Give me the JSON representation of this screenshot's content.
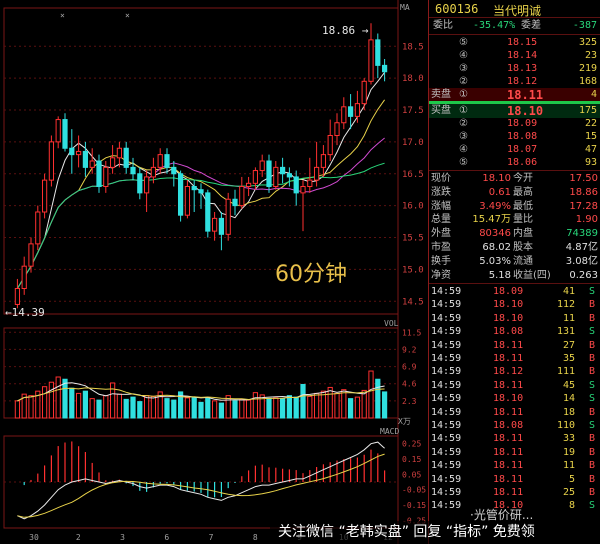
{
  "annotation": "60分钟",
  "chart_labels": {
    "ma_tag": "MA",
    "vol_tag": "VOL",
    "macd_tag": "MACD",
    "vol_unit": "X万",
    "high_label": "18.86 →",
    "low_label": "←14.39",
    "x_ticks": [
      "30",
      "2",
      "3",
      "6",
      "7",
      "8",
      "9",
      "10",
      "12"
    ]
  },
  "footer": {
    "text": "关注微信 “老韩实盘” 回复 “指标” 免费领",
    "wechat": "·光管价研..."
  },
  "chart_data": {
    "type": "candlestick",
    "price_ylim": [
      14.3,
      19.1
    ],
    "price_ticks": [
      "18.5",
      "18.0",
      "17.5",
      "17.0",
      "16.5",
      "16.0",
      "15.5",
      "15.0",
      "14.5"
    ],
    "vol_ticks": [
      "11.5",
      "9.2",
      "6.9",
      "4.6",
      "2.3"
    ],
    "macd_ticks": [
      "0.25",
      "0.15",
      "0.05",
      "-0.05",
      "-0.15",
      "-0.25"
    ],
    "candles": [
      [
        14.45,
        14.7,
        14.39,
        14.85
      ],
      [
        14.7,
        15.05,
        14.6,
        15.2
      ],
      [
        15.05,
        15.4,
        14.95,
        15.5
      ],
      [
        15.4,
        15.9,
        15.3,
        16.0
      ],
      [
        15.9,
        16.4,
        15.8,
        16.5
      ],
      [
        16.4,
        17.0,
        16.3,
        17.1
      ],
      [
        17.0,
        17.35,
        16.9,
        17.4
      ],
      [
        17.35,
        16.9,
        16.85,
        17.45
      ],
      [
        16.9,
        16.8,
        16.5,
        17.2
      ],
      [
        16.8,
        16.85,
        16.6,
        17.1
      ],
      [
        16.85,
        16.6,
        16.45,
        17.0
      ],
      [
        16.6,
        16.7,
        16.5,
        16.9
      ],
      [
        16.7,
        16.3,
        16.2,
        16.8
      ],
      [
        16.3,
        16.6,
        16.2,
        16.7
      ],
      [
        16.6,
        16.75,
        16.5,
        16.95
      ],
      [
        16.75,
        16.9,
        16.6,
        17.0
      ],
      [
        16.9,
        16.6,
        16.5,
        17.0
      ],
      [
        16.6,
        16.5,
        16.4,
        16.75
      ],
      [
        16.5,
        16.2,
        16.1,
        16.6
      ],
      [
        16.2,
        16.45,
        15.9,
        16.55
      ],
      [
        16.45,
        16.6,
        16.35,
        16.75
      ],
      [
        16.6,
        16.8,
        16.5,
        16.9
      ],
      [
        16.8,
        16.6,
        16.5,
        16.9
      ],
      [
        16.6,
        16.5,
        16.3,
        16.7
      ],
      [
        16.5,
        15.85,
        15.75,
        16.55
      ],
      [
        15.85,
        16.3,
        15.8,
        16.4
      ],
      [
        16.3,
        16.25,
        15.9,
        16.4
      ],
      [
        16.25,
        16.2,
        15.95,
        16.35
      ],
      [
        16.2,
        15.6,
        15.5,
        16.25
      ],
      [
        15.6,
        15.8,
        15.45,
        15.9
      ],
      [
        15.8,
        15.55,
        15.3,
        15.9
      ],
      [
        15.55,
        16.1,
        15.45,
        16.2
      ],
      [
        16.1,
        16.0,
        15.85,
        16.25
      ],
      [
        16.0,
        16.3,
        15.95,
        16.45
      ],
      [
        16.3,
        16.35,
        16.15,
        16.45
      ],
      [
        16.35,
        16.55,
        16.25,
        16.6
      ],
      [
        16.55,
        16.7,
        16.45,
        16.8
      ],
      [
        16.7,
        16.3,
        16.2,
        16.8
      ],
      [
        16.3,
        16.6,
        16.25,
        16.7
      ],
      [
        16.6,
        16.5,
        16.35,
        16.75
      ],
      [
        16.5,
        16.45,
        16.3,
        16.6
      ],
      [
        16.45,
        16.2,
        16.0,
        16.55
      ],
      [
        16.2,
        16.3,
        15.6,
        16.4
      ],
      [
        16.3,
        16.4,
        16.2,
        16.75
      ],
      [
        16.4,
        16.6,
        16.3,
        17.0
      ],
      [
        16.6,
        16.8,
        16.45,
        16.95
      ],
      [
        16.8,
        17.1,
        16.7,
        17.35
      ],
      [
        17.1,
        17.3,
        16.95,
        17.45
      ],
      [
        17.3,
        17.55,
        17.2,
        17.7
      ],
      [
        17.55,
        17.4,
        17.2,
        17.75
      ],
      [
        17.4,
        17.6,
        17.3,
        17.8
      ],
      [
        17.6,
        17.95,
        17.5,
        18.0
      ],
      [
        17.95,
        18.6,
        17.9,
        18.86
      ],
      [
        18.6,
        18.2,
        18.0,
        18.7
      ],
      [
        18.2,
        18.1,
        17.95,
        18.3
      ]
    ],
    "volumes": [
      [
        2.3,
        1
      ],
      [
        3.2,
        1
      ],
      [
        3.0,
        1
      ],
      [
        3.6,
        1
      ],
      [
        4.2,
        1
      ],
      [
        4.8,
        1
      ],
      [
        5.5,
        1
      ],
      [
        5.2,
        0
      ],
      [
        4.0,
        0
      ],
      [
        3.3,
        1
      ],
      [
        3.6,
        0
      ],
      [
        2.6,
        1
      ],
      [
        2.4,
        0
      ],
      [
        3.0,
        1
      ],
      [
        4.7,
        1
      ],
      [
        3.2,
        1
      ],
      [
        2.5,
        0
      ],
      [
        2.8,
        0
      ],
      [
        2.2,
        0
      ],
      [
        3.0,
        1
      ],
      [
        2.9,
        1
      ],
      [
        3.5,
        1
      ],
      [
        2.6,
        0
      ],
      [
        2.4,
        0
      ],
      [
        3.5,
        0
      ],
      [
        2.7,
        1
      ],
      [
        2.8,
        0
      ],
      [
        2.1,
        0
      ],
      [
        2.7,
        0
      ],
      [
        2.3,
        1
      ],
      [
        2.0,
        0
      ],
      [
        3.0,
        1
      ],
      [
        2.3,
        0
      ],
      [
        2.5,
        1
      ],
      [
        2.4,
        1
      ],
      [
        3.4,
        1
      ],
      [
        3.1,
        1
      ],
      [
        2.6,
        0
      ],
      [
        2.7,
        1
      ],
      [
        2.6,
        0
      ],
      [
        3.0,
        0
      ],
      [
        2.8,
        0
      ],
      [
        4.5,
        0
      ],
      [
        2.9,
        1
      ],
      [
        3.3,
        1
      ],
      [
        3.6,
        1
      ],
      [
        4.1,
        1
      ],
      [
        3.3,
        1
      ],
      [
        3.8,
        1
      ],
      [
        2.6,
        0
      ],
      [
        2.8,
        1
      ],
      [
        3.7,
        1
      ],
      [
        6.3,
        1
      ],
      [
        5.2,
        0
      ],
      [
        3.5,
        0
      ]
    ],
    "macd": [
      -0.22,
      -0.24,
      -0.22,
      -0.19,
      -0.15,
      -0.1,
      -0.05,
      -0.02,
      0.0,
      0.01,
      0.02,
      0.01,
      0.0,
      -0.01,
      0.0,
      0.01,
      0.0,
      -0.01,
      -0.03,
      -0.04,
      -0.03,
      -0.02,
      -0.02,
      -0.03,
      -0.05,
      -0.06,
      -0.07,
      -0.08,
      -0.1,
      -0.11,
      -0.12,
      -0.1,
      -0.09,
      -0.07,
      -0.05,
      -0.03,
      -0.02,
      -0.02,
      -0.01,
      0.0,
      0.01,
      0.02,
      0.02,
      0.04,
      0.06,
      0.08,
      0.1,
      0.12,
      0.14,
      0.16,
      0.18,
      0.21,
      0.25,
      0.26,
      0.22
    ]
  },
  "panel": {
    "code": "600136",
    "name": "当代明诚",
    "weibi_label": "委比",
    "weibi": "-35.47%",
    "weicha_label": "委差",
    "weicha": "-387",
    "sell": [
      {
        "n": "⑤",
        "price": "18.15",
        "vol": "325"
      },
      {
        "n": "④",
        "price": "18.14",
        "vol": "23"
      },
      {
        "n": "③",
        "price": "18.13",
        "vol": "219"
      },
      {
        "n": "②",
        "price": "18.12",
        "vol": "168"
      },
      {
        "n": "①",
        "price": "18.11",
        "vol": "4",
        "lbl": "卖盘"
      }
    ],
    "buy": [
      {
        "n": "①",
        "price": "18.10",
        "vol": "175",
        "lbl": "买盘"
      },
      {
        "n": "②",
        "price": "18.09",
        "vol": "22"
      },
      {
        "n": "③",
        "price": "18.08",
        "vol": "15"
      },
      {
        "n": "④",
        "price": "18.07",
        "vol": "47"
      },
      {
        "n": "⑤",
        "price": "18.06",
        "vol": "93"
      }
    ],
    "stats": [
      {
        "l1": "现价",
        "v1": "18.10",
        "l2": "今开",
        "v2": "17.50",
        "c1": "red",
        "c2": "red"
      },
      {
        "l1": "涨跌",
        "v1": "0.61",
        "l2": "最高",
        "v2": "18.86",
        "c1": "red",
        "c2": "red"
      },
      {
        "l1": "涨幅",
        "v1": "3.49%",
        "l2": "最低",
        "v2": "17.28",
        "c1": "red",
        "c2": "red"
      },
      {
        "l1": "总量",
        "v1": "15.47万",
        "l2": "量比",
        "v2": "1.90",
        "c1": "yel",
        "c2": "red"
      },
      {
        "l1": "外盘",
        "v1": "80346",
        "l2": "内盘",
        "v2": "74389",
        "c1": "red",
        "c2": "grn"
      },
      {
        "l1": "市盈",
        "v1": "68.02",
        "l2": "股本",
        "v2": "4.87亿",
        "c1": "wht",
        "c2": "wht"
      },
      {
        "l1": "换手",
        "v1": "5.03%",
        "l2": "流通",
        "v2": "3.08亿",
        "c1": "wht",
        "c2": "wht"
      },
      {
        "l1": "净资",
        "v1": "5.18",
        "l2": "收益(四)",
        "v2": "0.263",
        "c1": "wht",
        "c2": "wht"
      }
    ],
    "ticks": [
      {
        "t": "14:59",
        "p": "18.09",
        "v": "41",
        "f": "S"
      },
      {
        "t": "14:59",
        "p": "18.10",
        "v": "112",
        "f": "B"
      },
      {
        "t": "14:59",
        "p": "18.10",
        "v": "11",
        "f": "B"
      },
      {
        "t": "14:59",
        "p": "18.08",
        "v": "131",
        "f": "S"
      },
      {
        "t": "14:59",
        "p": "18.11",
        "v": "27",
        "f": "B"
      },
      {
        "t": "14:59",
        "p": "18.11",
        "v": "35",
        "f": "B"
      },
      {
        "t": "14:59",
        "p": "18.12",
        "v": "111",
        "f": "B"
      },
      {
        "t": "14:59",
        "p": "18.11",
        "v": "45",
        "f": "S"
      },
      {
        "t": "14:59",
        "p": "18.10",
        "v": "14",
        "f": "S"
      },
      {
        "t": "14:59",
        "p": "18.11",
        "v": "18",
        "f": "B"
      },
      {
        "t": "14:59",
        "p": "18.08",
        "v": "110",
        "f": "S"
      },
      {
        "t": "14:59",
        "p": "18.11",
        "v": "33",
        "f": "B"
      },
      {
        "t": "14:59",
        "p": "18.11",
        "v": "19",
        "f": "B"
      },
      {
        "t": "14:59",
        "p": "18.11",
        "v": "11",
        "f": "B"
      },
      {
        "t": "14:59",
        "p": "18.11",
        "v": "5",
        "f": "B"
      },
      {
        "t": "14:59",
        "p": "18.11",
        "v": "25",
        "f": "B"
      },
      {
        "t": "14:59",
        "p": "18.10",
        "v": "8",
        "f": "S"
      }
    ]
  }
}
